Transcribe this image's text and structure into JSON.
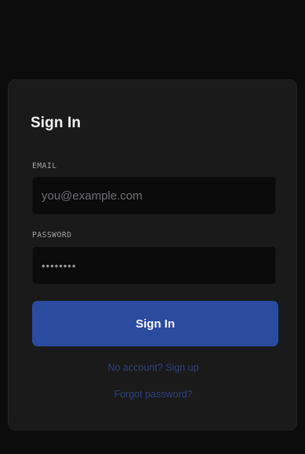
{
  "signin_form": {
    "title": "Sign In",
    "email_label": "EMAIL",
    "email_placeholder": "you@example.com",
    "password_label": "PASSWORD",
    "password_value": "••••••••",
    "submit_label": "Sign In",
    "signup_link": "No account? Sign up",
    "forgot_link": "Forgot password?"
  },
  "colors": {
    "background": "#0c0c0d",
    "card": "#1a1a1b",
    "primary_button": "#2b4b9f",
    "link": "#2b427e"
  }
}
